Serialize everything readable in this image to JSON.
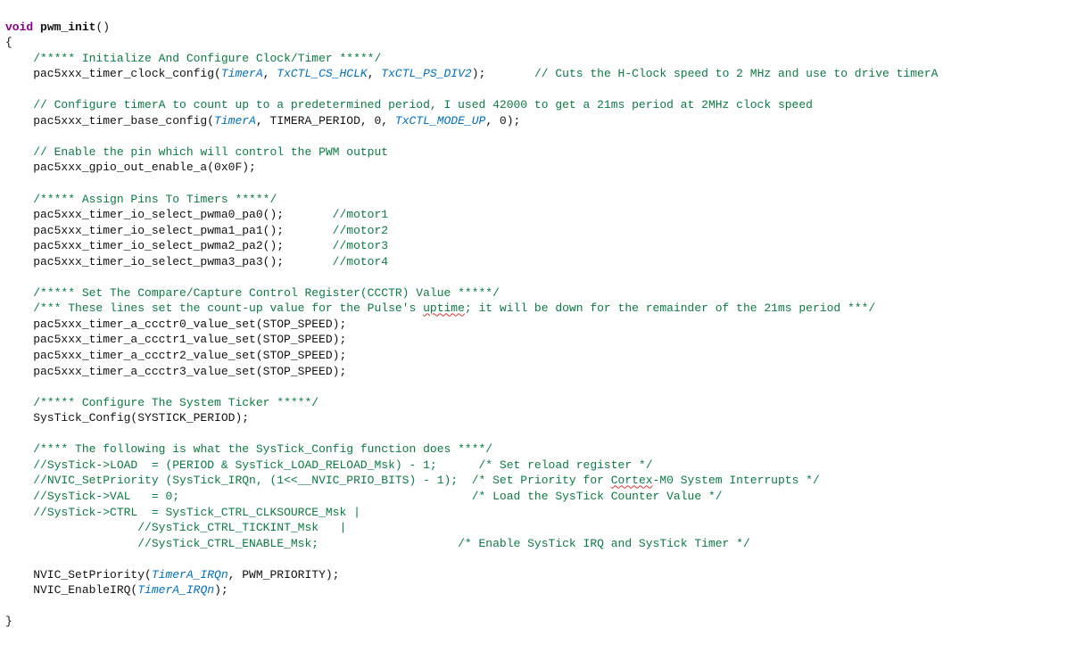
{
  "code": {
    "l1_kw": "void",
    "l1_fn": "pwm_init",
    "l1_rest": "()",
    "l2": "{",
    "l3_cmt": "/***** Initialize And Configure Clock/Timer *****/",
    "l4a": "    pac5xxx_timer_clock_config(",
    "l4b": "TimerA",
    "l4c": ", ",
    "l4d": "TxCTL_CS_HCLK",
    "l4e": ", ",
    "l4f": "TxCTL_PS_DIV2",
    "l4g": ");",
    "l4pad": "       ",
    "l4cmt": "// Cuts the H-Clock speed to 2 MHz and use to drive timerA",
    "l5": "",
    "l6_cmt": "// Configure timerA to count up to a predetermined period, I used 42000 to get a 21ms period at 2MHz clock speed",
    "l7a": "    pac5xxx_timer_base_config(",
    "l7b": "TimerA",
    "l7c": ", TIMERA_PERIOD, 0, ",
    "l7d": "TxCTL_MODE_UP",
    "l7e": ", 0);",
    "l8": "",
    "l9_cmt": "// Enable the pin which will control the PWM output",
    "l10": "    pac5xxx_gpio_out_enable_a(0x0F);",
    "l11": "",
    "l12_cmt": "/***** Assign Pins To Timers *****/",
    "l13": "    pac5xxx_timer_io_select_pwma0_pa0();",
    "l13pad": "       ",
    "l13cmt": "//motor1",
    "l14": "    pac5xxx_timer_io_select_pwma1_pa1();",
    "l14pad": "       ",
    "l14cmt": "//motor2",
    "l15": "    pac5xxx_timer_io_select_pwma2_pa2();",
    "l15pad": "       ",
    "l15cmt": "//motor3",
    "l16": "    pac5xxx_timer_io_select_pwma3_pa3();",
    "l16pad": "       ",
    "l16cmt": "//motor4",
    "l17": "",
    "l18_cmt": "/***** Set The Compare/Capture Control Register(CCCTR) Value *****/",
    "l19_pre": "/*** These lines set the count-up value for the Pulse's ",
    "l19_err": "uptime",
    "l19_post": "; it will be down for the remainder of the 21ms period ***/",
    "l20": "    pac5xxx_timer_a_ccctr0_value_set(STOP_SPEED);",
    "l21": "    pac5xxx_timer_a_ccctr1_value_set(STOP_SPEED);",
    "l22": "    pac5xxx_timer_a_ccctr2_value_set(STOP_SPEED);",
    "l23": "    pac5xxx_timer_a_ccctr3_value_set(STOP_SPEED);",
    "l24": "",
    "l25_cmt": "/***** Configure The System Ticker *****/",
    "l26": "    SysTick_Config(SYSTICK_PERIOD);",
    "l27": "",
    "l28_cmt": "/**** The following is what the SysTick_Config function does ****/",
    "l29_cmt": "//SysTick->LOAD  = (PERIOD & SysTick_LOAD_RELOAD_Msk) - 1;      /* Set reload register */",
    "l30a": "//NVIC_SetPriority (SysTick_IRQn, (1<<__NVIC_PRIO_BITS) - 1);  /* Set Priority for ",
    "l30b": "Cortex",
    "l30c": "-M0 System Interrupts */",
    "l31_cmt": "//SysTick->VAL   = 0;                                          /* Load the SysTick Counter Value */",
    "l32_cmt": "//SysTick->CTRL  = SysTick_CTRL_CLKSOURCE_Msk |",
    "l33_cmt": "               //SysTick_CTRL_TICKINT_Msk   |",
    "l34_cmt": "               //SysTick_CTRL_ENABLE_Msk;                    /* Enable SysTick IRQ and SysTick Timer */",
    "l35": "",
    "l36a": "    NVIC_SetPriority(",
    "l36b": "TimerA_IRQn",
    "l36c": ", PWM_PRIORITY);",
    "l37a": "    NVIC_EnableIRQ(",
    "l37b": "TimerA_IRQn",
    "l37c": ");",
    "l38": "",
    "l39": "}"
  }
}
